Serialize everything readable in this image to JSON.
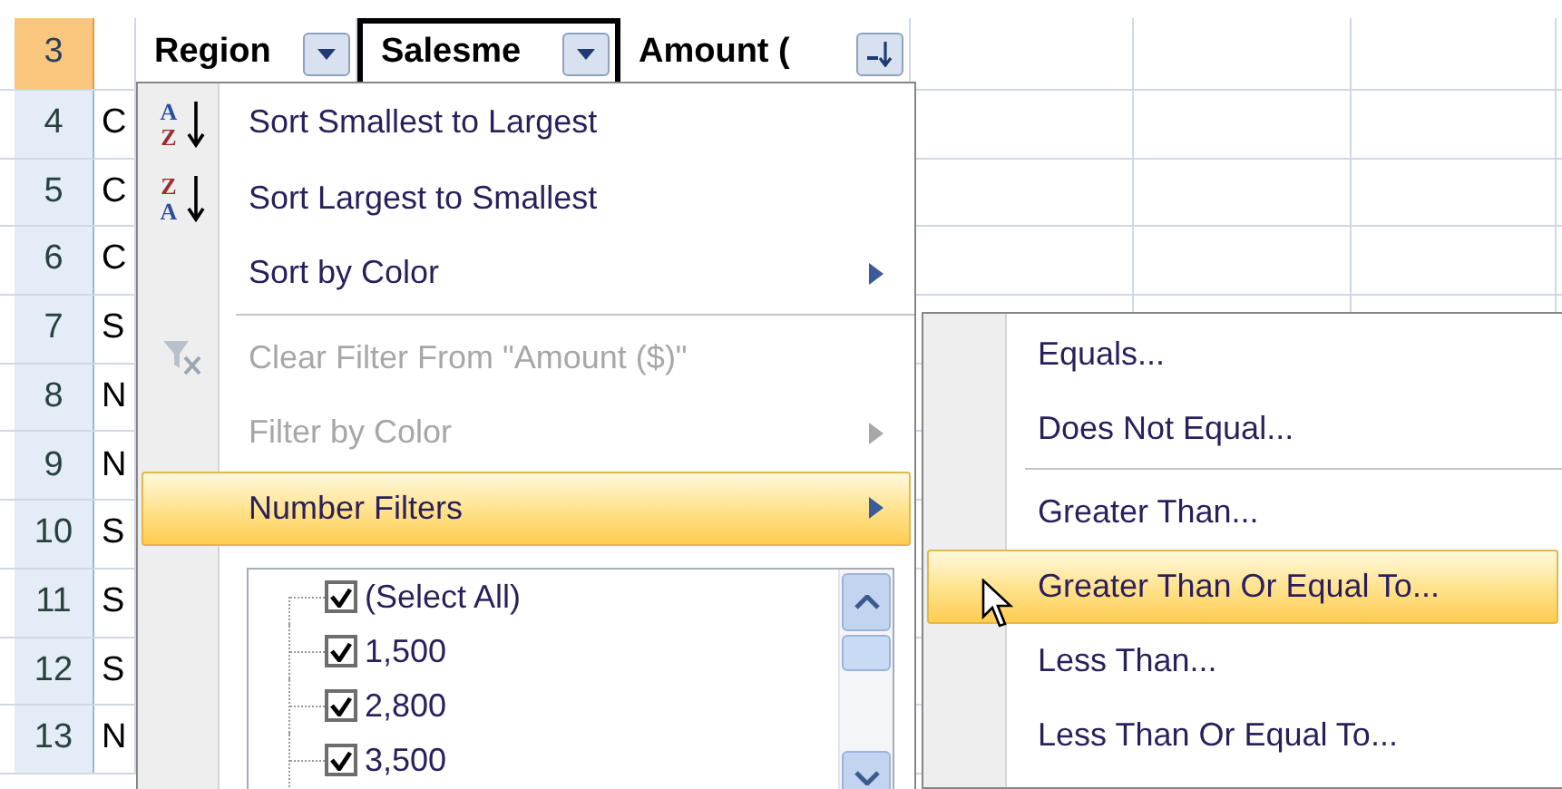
{
  "header_cells": [
    {
      "text": "Region",
      "selected": false,
      "filter_button": {
        "kind": "dropdown"
      }
    },
    {
      "text": "Salesme",
      "selected": true,
      "filter_button": {
        "kind": "dropdown"
      }
    },
    {
      "text": "Amount (",
      "selected": false,
      "filter_button": {
        "kind": "sorted"
      }
    }
  ],
  "rows": [
    {
      "number": "3",
      "selected": true
    },
    {
      "number": "4",
      "selected": false,
      "column_a": "C"
    },
    {
      "number": "5",
      "selected": false,
      "column_a": "C"
    },
    {
      "number": "6",
      "selected": false,
      "column_a": "C"
    },
    {
      "number": "7",
      "selected": false,
      "column_a": "S"
    },
    {
      "number": "8",
      "selected": false,
      "column_a": "N"
    },
    {
      "number": "9",
      "selected": false,
      "column_a": "N"
    },
    {
      "number": "10",
      "selected": false,
      "column_a": "S"
    },
    {
      "number": "11",
      "selected": false,
      "column_a": "S"
    },
    {
      "number": "12",
      "selected": false,
      "column_a": "S"
    },
    {
      "number": "13",
      "selected": false,
      "column_a": "N"
    }
  ],
  "filter_menu": {
    "items": [
      {
        "kind": "command",
        "label": "Sort Smallest to Largest",
        "icon": {
          "kind": "sort",
          "letters": [
            "A",
            "Z"
          ]
        },
        "disabled": false,
        "submenu": false,
        "selected": false
      },
      {
        "kind": "command",
        "label": "Sort Largest to Smallest",
        "icon": {
          "kind": "sort",
          "letters": [
            "Z",
            "A"
          ]
        },
        "disabled": false,
        "submenu": false,
        "selected": false
      },
      {
        "kind": "command",
        "label": "Sort by Color",
        "disabled": false,
        "submenu": true,
        "selected": false
      },
      {
        "kind": "separator"
      },
      {
        "kind": "command",
        "label": "Clear Filter From \"Amount ($)\"",
        "icon": {
          "kind": "clear_filter"
        },
        "disabled": true,
        "submenu": false,
        "selected": false
      },
      {
        "kind": "command",
        "label": "Filter by Color",
        "disabled": true,
        "submenu": true,
        "selected": false
      },
      {
        "kind": "command",
        "label": "Number Filters",
        "disabled": false,
        "submenu": true,
        "selected": true
      }
    ],
    "value_list": [
      {
        "label": "(Select All)",
        "checked": true
      },
      {
        "label": "1,500",
        "checked": true
      },
      {
        "label": "2,800",
        "checked": true
      },
      {
        "label": "3,500",
        "checked": true
      }
    ]
  },
  "number_filters_submenu": {
    "items": [
      {
        "kind": "command",
        "label": "Equals...",
        "selected": false
      },
      {
        "kind": "command",
        "label": "Does Not Equal...",
        "selected": false
      },
      {
        "kind": "separator"
      },
      {
        "kind": "command",
        "label": "Greater Than...",
        "selected": false
      },
      {
        "kind": "command",
        "label": "Greater Than Or Equal To...",
        "selected": true
      },
      {
        "kind": "command",
        "label": "Less Than...",
        "selected": false
      },
      {
        "kind": "command",
        "label": "Less Than Or Equal To...",
        "selected": false
      }
    ]
  }
}
